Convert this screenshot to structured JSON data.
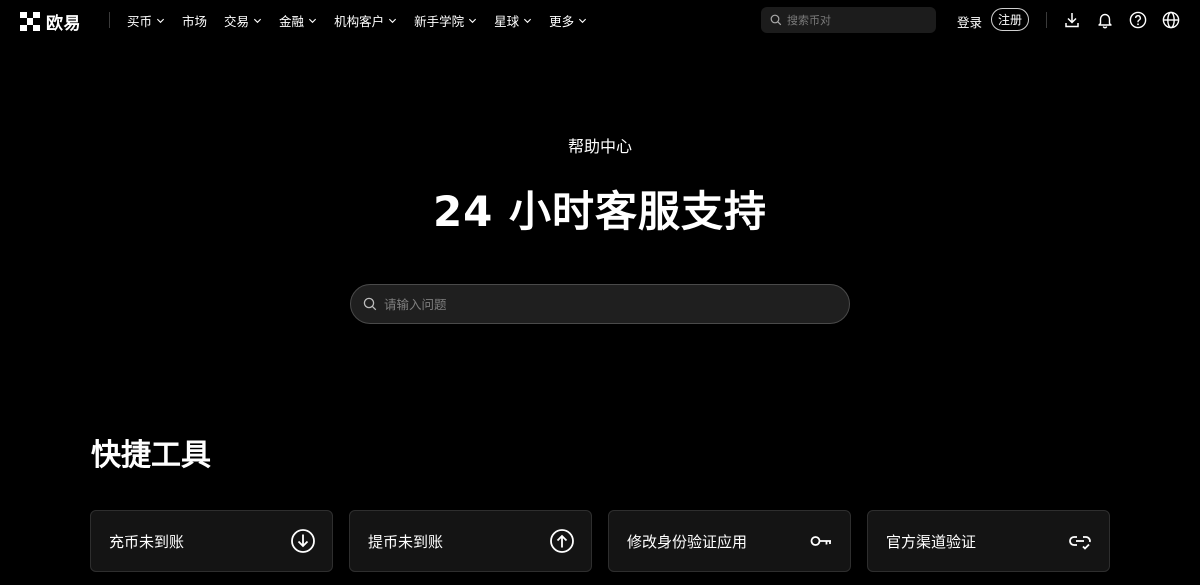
{
  "brand": {
    "name": "欧易"
  },
  "nav": {
    "items": [
      {
        "label": "买币",
        "dropdown": true
      },
      {
        "label": "市场",
        "dropdown": false
      },
      {
        "label": "交易",
        "dropdown": true
      },
      {
        "label": "金融",
        "dropdown": true
      },
      {
        "label": "机构客户",
        "dropdown": true
      },
      {
        "label": "新手学院",
        "dropdown": true
      },
      {
        "label": "星球",
        "dropdown": true
      },
      {
        "label": "更多",
        "dropdown": true
      }
    ],
    "search_placeholder": "搜索币对",
    "login_label": "登录",
    "register_label": "注册",
    "icons": [
      "download-icon",
      "bell-icon",
      "help-icon",
      "globe-icon"
    ]
  },
  "hero": {
    "kicker": "帮助中心",
    "title": "24 小时客服支持",
    "search_placeholder": "请输入问题"
  },
  "quick_tools": {
    "title": "快捷工具",
    "items": [
      {
        "label": "充币未到账",
        "icon": "download-circle-icon"
      },
      {
        "label": "提币未到账",
        "icon": "upload-circle-icon"
      },
      {
        "label": "修改身份验证应用",
        "icon": "key-icon"
      },
      {
        "label": "官方渠道验证",
        "icon": "link-check-icon"
      }
    ]
  },
  "colors": {
    "background": "#000000",
    "text": "#ffffff",
    "card": "#141414",
    "border": "#2e2e2e"
  }
}
